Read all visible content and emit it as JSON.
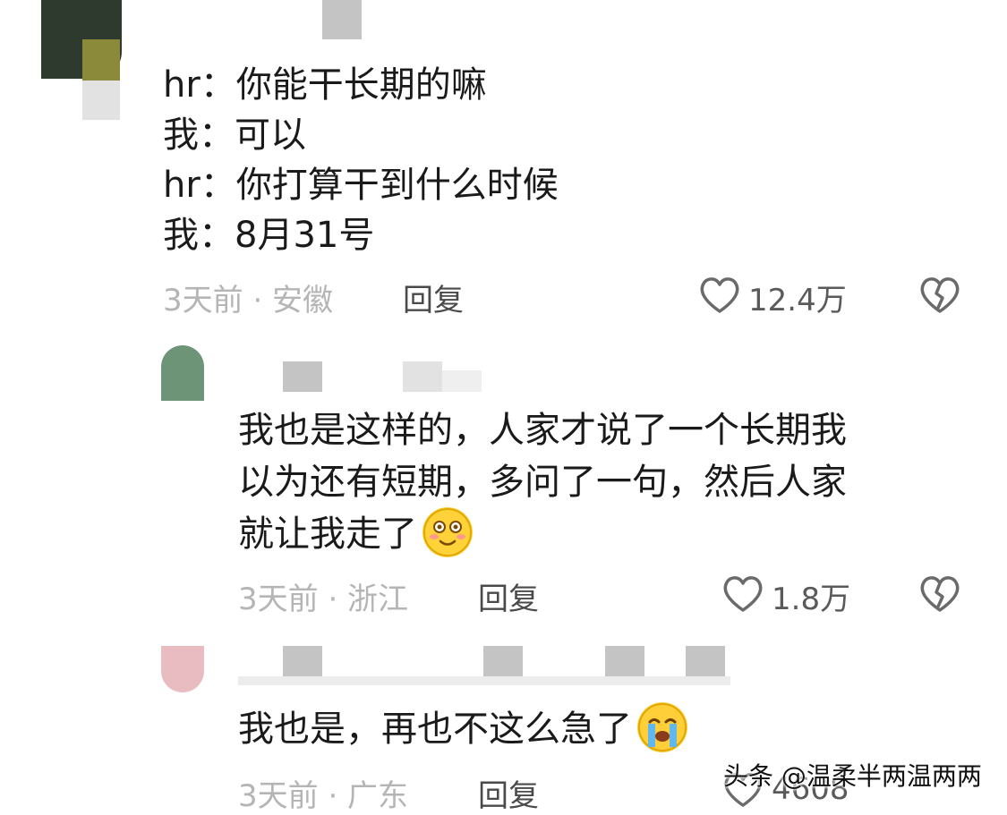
{
  "comments": [
    {
      "lines": [
        "hr：你能干长期的嘛",
        "我：可以",
        "hr：你打算干到什么时候",
        "我：8月31号"
      ],
      "time_location": "3天前 · 安徽",
      "reply_label": "回复",
      "like_count": "12.4万",
      "avatar_color": "#2e3a2e"
    },
    {
      "lines": [
        "我也是这样的，人家才说了一个长期我",
        "以为还有短期，多问了一句，然后人家",
        "就让我走了"
      ],
      "emoji": "smile-emoji",
      "time_location": "3天前 · 浙江",
      "reply_label": "回复",
      "like_count": "1.8万",
      "avatar_color": "#6e9478"
    },
    {
      "lines": [
        "我也是，再也不这么急了"
      ],
      "emoji": "crying-emoji",
      "time_location": "3天前 · 广东",
      "reply_label": "回复",
      "like_count": "4608",
      "avatar_color": "#e8bcc0"
    }
  ],
  "icons": {
    "like": "heart-outline-icon",
    "dislike": "broken-heart-icon"
  },
  "watermark": "头条 @温柔半两温两两"
}
